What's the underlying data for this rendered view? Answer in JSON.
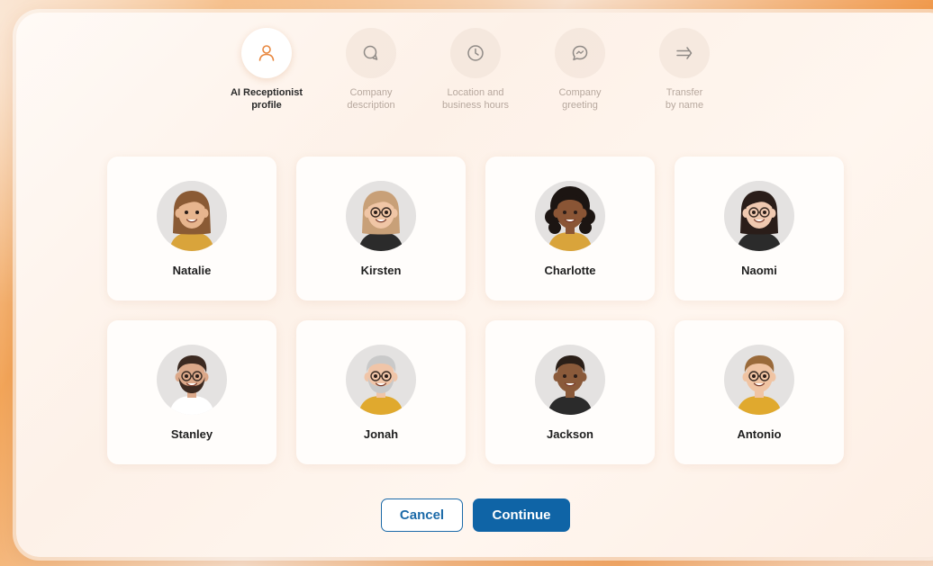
{
  "stepper": {
    "steps": [
      {
        "line1": "AI Receptionist",
        "line2": "profile",
        "icon": "person-icon",
        "active": true
      },
      {
        "line1": "Company",
        "line2": "description",
        "icon": "chat-bubbles-icon",
        "active": false
      },
      {
        "line1": "Location and",
        "line2": "business hours",
        "icon": "clock-icon",
        "active": false
      },
      {
        "line1": "Company",
        "line2": "greeting",
        "icon": "message-icon",
        "active": false
      },
      {
        "line1": "Transfer",
        "line2": "by name",
        "icon": "double-arrow-icon",
        "active": false
      }
    ]
  },
  "profiles": [
    {
      "name": "Natalie",
      "skin": "#e7b58e",
      "hair": "#8a5a34",
      "hair_style": "long",
      "glasses": false,
      "shirt": "#d9a43b"
    },
    {
      "name": "Kirsten",
      "skin": "#f0c6a6",
      "hair": "#c8a078",
      "hair_style": "long",
      "glasses": true,
      "shirt": "#2b2b2b"
    },
    {
      "name": "Charlotte",
      "skin": "#8a5535",
      "hair": "#1c1512",
      "hair_style": "curly",
      "glasses": false,
      "shirt": "#d9a43b"
    },
    {
      "name": "Naomi",
      "skin": "#f0c9b0",
      "hair": "#2a1d19",
      "hair_style": "long",
      "glasses": true,
      "shirt": "#2b2b2b"
    },
    {
      "name": "Stanley",
      "skin": "#dba889",
      "hair": "#3c2a21",
      "hair_style": "short",
      "glasses": true,
      "beard": true,
      "shirt": "#ffffff"
    },
    {
      "name": "Jonah",
      "skin": "#f0c5a8",
      "hair": "#c9c9c9",
      "hair_style": "short",
      "glasses": true,
      "beard": true,
      "shirt": "#e0a92e"
    },
    {
      "name": "Jackson",
      "skin": "#8a5a3a",
      "hair": "#2a1f18",
      "hair_style": "short",
      "glasses": false,
      "shirt": "#2b2b2b"
    },
    {
      "name": "Antonio",
      "skin": "#f0c4a3",
      "hair": "#9a6a3a",
      "hair_style": "short",
      "glasses": true,
      "shirt": "#e0a92e"
    }
  ],
  "actions": {
    "cancel_label": "Cancel",
    "continue_label": "Continue"
  },
  "colors": {
    "accent": "#0f64a6",
    "active_step_icon": "#e8873e",
    "inactive_step_icon": "#8f8a86"
  }
}
